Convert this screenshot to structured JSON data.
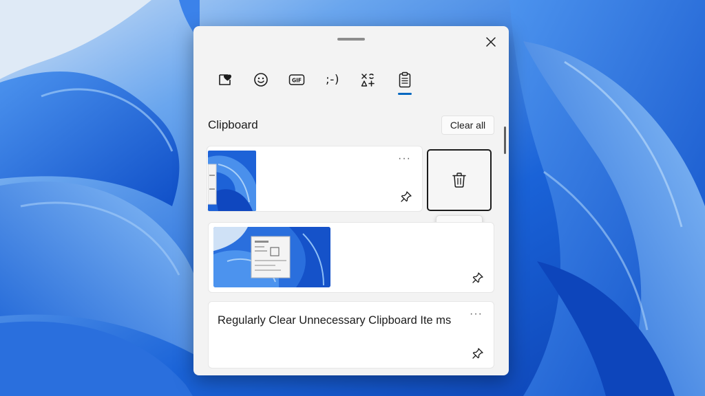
{
  "wallpaper": {
    "theme": "windows-11-bloom",
    "primary_color": "#1f66d9",
    "accent_color": "#7fb4f3"
  },
  "panel": {
    "close_icon": "close-icon",
    "tabs": [
      {
        "id": "favorites",
        "icon": "heart-sticker-icon"
      },
      {
        "id": "emoji",
        "icon": "smiley-icon"
      },
      {
        "id": "gif",
        "icon": "gif-icon",
        "label": "GIF"
      },
      {
        "id": "kaomoji",
        "icon": "kaomoji-icon",
        "label": ";-)"
      },
      {
        "id": "symbols",
        "icon": "symbols-icon"
      },
      {
        "id": "clipboard",
        "icon": "clipboard-icon",
        "selected": true
      }
    ],
    "accent_color": "#0067c0"
  },
  "clipboard": {
    "title": "Clipboard",
    "clear_all_label": "Clear all",
    "items": [
      {
        "type": "image",
        "more_label": "···"
      },
      {
        "type": "image"
      },
      {
        "type": "text",
        "text": "Regularly Clear Unnecessary Clipboard Ite ms",
        "more_label": "···"
      }
    ],
    "delete_tooltip": "Delete"
  }
}
